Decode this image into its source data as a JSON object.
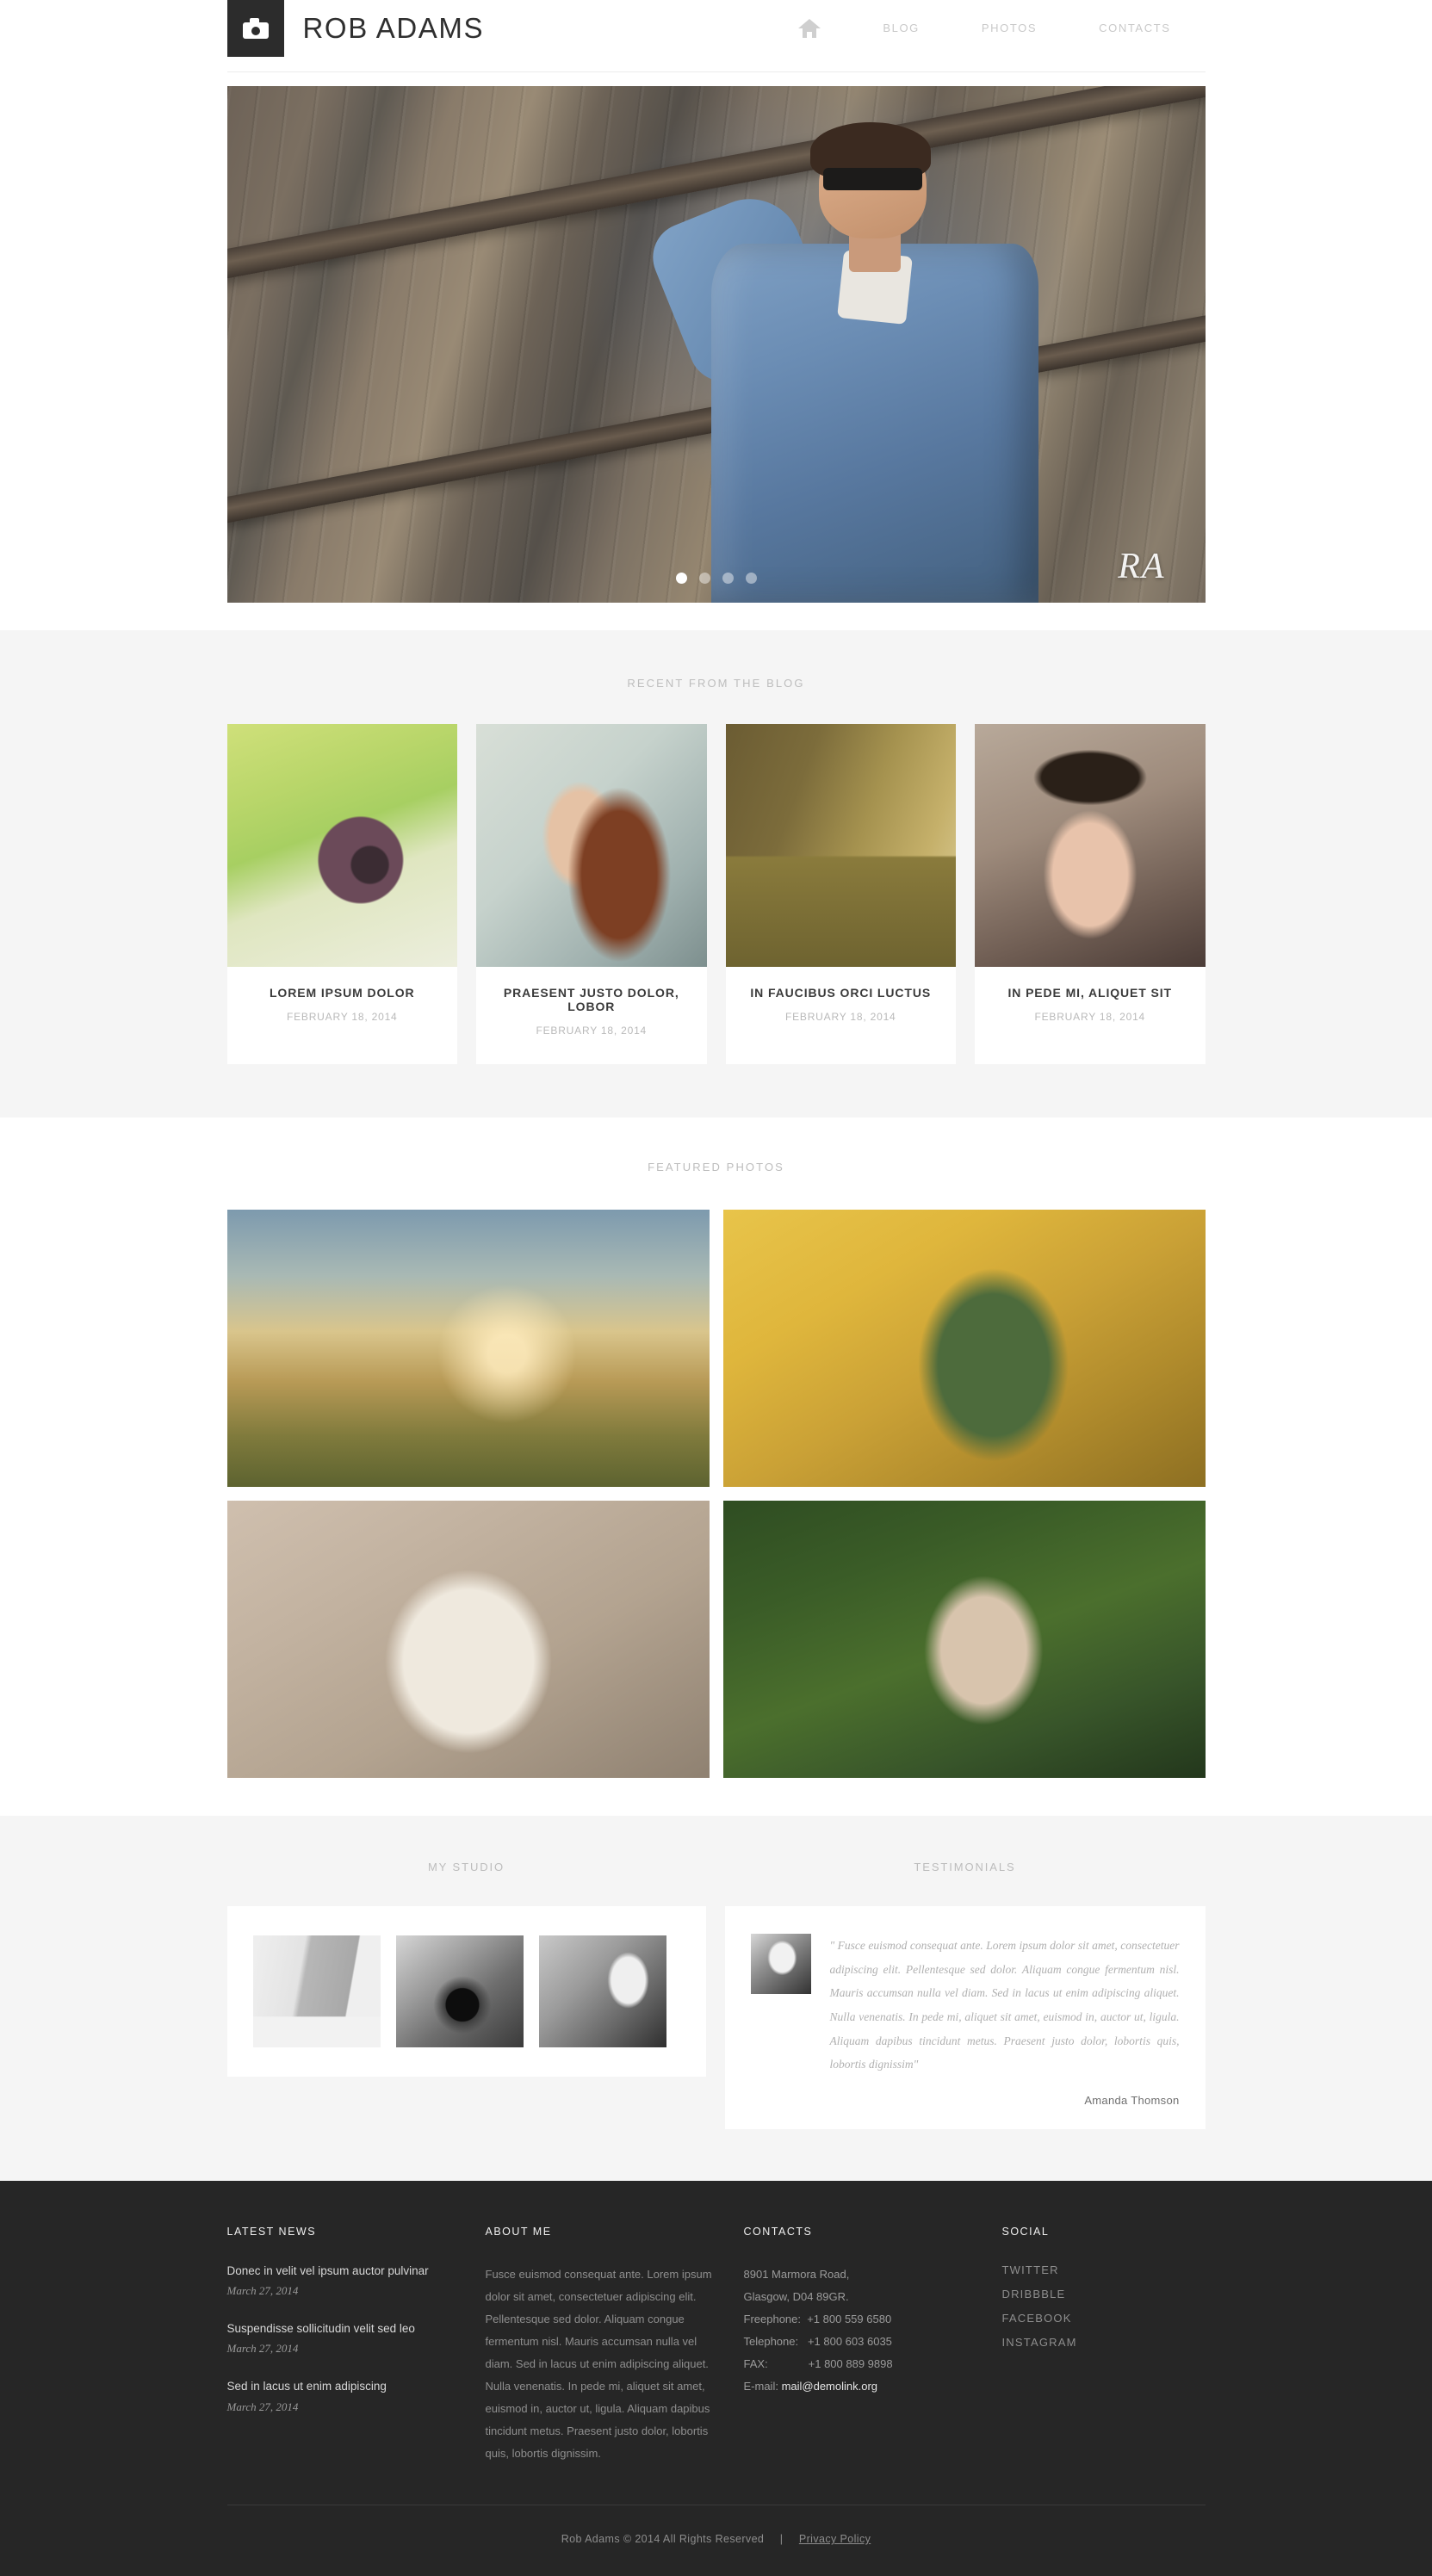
{
  "header": {
    "logo_icon": "camera-icon",
    "logo_text": "ROB ADAMS",
    "nav": [
      {
        "label": "",
        "icon": "home-icon",
        "active": true
      },
      {
        "label": "BLOG",
        "icon": "",
        "active": false
      },
      {
        "label": "PHOTOS",
        "icon": "",
        "active": false
      },
      {
        "label": "CONTACTS",
        "icon": "",
        "active": false
      }
    ]
  },
  "slider": {
    "signature": "RA",
    "dots": 4,
    "active_dot": 1,
    "alt": "Man in denim jacket and sunglasses leaning against a rusty barn wall"
  },
  "blog": {
    "heading": "RECENT FROM THE BLOG",
    "posts": [
      {
        "title": "LOREM IPSUM DOLOR",
        "date": "FEBRUARY 18, 2014",
        "thumb": "th-camera",
        "alt": "Hand holding vintage film camera over green grass"
      },
      {
        "title": "PRAESENT JUSTO DOLOR, LOBOR",
        "date": "FEBRUARY 18, 2014",
        "thumb": "th-woman",
        "alt": "Profile portrait of red-haired woman"
      },
      {
        "title": "IN FAUCIBUS ORCI LUCTUS",
        "date": "FEBRUARY 18, 2014",
        "thumb": "th-barn",
        "alt": "Old wooden barn in a golden field"
      },
      {
        "title": "IN PEDE MI, ALIQUET SIT",
        "date": "FEBRUARY 18, 2014",
        "thumb": "th-goggles",
        "alt": "Woman wearing steampunk hat with goggles"
      }
    ]
  },
  "featured": {
    "heading": "FEATURED PHOTOS",
    "photos": [
      {
        "cls": "ft-horse",
        "alt": "Woman with white horse at sunrise in a meadow"
      },
      {
        "cls": "ft-field",
        "alt": "Woman in green dress in a golden field"
      },
      {
        "cls": "ft-swing",
        "alt": "Woman in white hat on a swing"
      },
      {
        "cls": "ft-grass",
        "alt": "Woman holding wildflowers in tall green grass"
      }
    ]
  },
  "studio": {
    "heading": "MY STUDIO",
    "thumbs": [
      {
        "cls": "st1",
        "alt": "Empty photo studio with softbox lights and backdrop"
      },
      {
        "cls": "st2",
        "alt": "Close-up of a vintage SLR camera on wood"
      },
      {
        "cls": "st3",
        "alt": "Photographer laughing while shooting with telephoto lens"
      }
    ]
  },
  "testimonials": {
    "heading": "TESTIMONIALS",
    "avatar_alt": "Black and white portrait of a woman",
    "quote": "\" Fusce euismod consequat ante. Lorem ipsum dolor sit amet, consectetuer adipiscing elit. Pellentesque sed dolor. Aliquam congue fermentum nisl. Mauris accumsan nulla vel diam. Sed in lacus ut enim adipiscing aliquet. Nulla venenatis. In pede mi, aliquet sit amet, euismod in, auctor ut, ligula. Aliquam dapibus tincidunt metus. Praesent justo dolor, lobortis quis, lobortis dignissim\"",
    "author": "Amanda Thomson"
  },
  "footer": {
    "news": {
      "title": "LATEST NEWS",
      "items": [
        {
          "title": "Donec in velit vel ipsum auctor pulvinar",
          "date": "March 27, 2014"
        },
        {
          "title": "Suspendisse sollicitudin velit sed leo",
          "date": "March 27, 2014"
        },
        {
          "title": "Sed in lacus ut enim adipiscing",
          "date": "March 27, 2014"
        }
      ]
    },
    "about": {
      "title": "ABOUT ME",
      "text": "Fusce euismod consequat ante. Lorem ipsum dolor sit amet, consectetuer adipiscing elit. Pellentesque sed dolor. Aliquam congue fermentum nisl. Mauris accumsan nulla vel diam. Sed in lacus ut enim adipiscing aliquet. Nulla venenatis. In pede mi, aliquet sit amet, euismod in, auctor ut, ligula. Aliquam dapibus tincidunt metus. Praesent justo dolor, lobortis quis, lobortis dignissim."
    },
    "contacts": {
      "title": "CONTACTS",
      "address1": "8901 Marmora Road,",
      "address2": "Glasgow, D04 89GR.",
      "freephone": "Freephone:  +1 800 559 6580",
      "telephone": "Telephone:   +1 800 603 6035",
      "fax": "FAX:             +1 800 889 9898",
      "email_label": "E-mail: ",
      "email": "mail@demolink.org"
    },
    "social": {
      "title": "SOCIAL",
      "links": [
        "TWITTER",
        "DRIBBBLE",
        "FACEBOOK",
        "INSTAGRAM"
      ]
    },
    "copyright": "Rob Adams © 2014 All Rights Reserved",
    "separator": "|",
    "privacy": "Privacy Policy"
  }
}
